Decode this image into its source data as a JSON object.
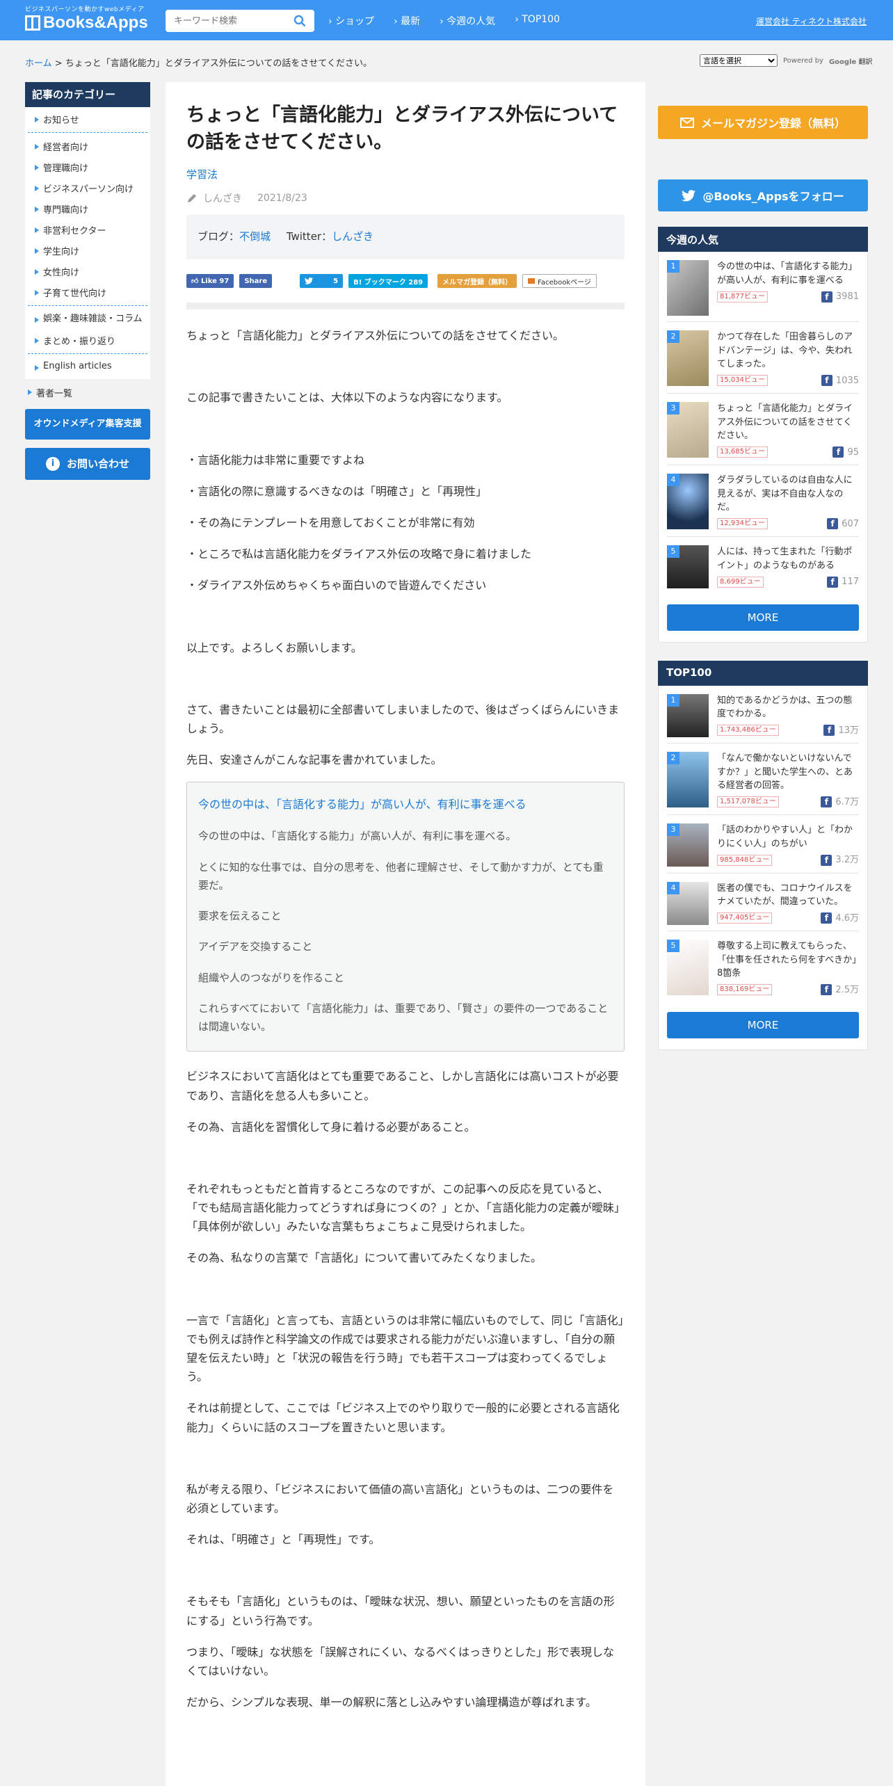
{
  "header": {
    "tagline": "ビジネスパーソンを動かすwebメディア",
    "logo": "Books&Apps",
    "search_placeholder": "キーワード検索",
    "nav": [
      "ショップ",
      "最新",
      "今週の人気",
      "TOP100"
    ],
    "operator": "運営会社 ティネクト株式会社"
  },
  "breadcrumb": {
    "home": "ホーム",
    "sep": " > ",
    "current": "ちょっと「言語化能力」とダライアス外伝についての話をさせてください。"
  },
  "translate": {
    "select": "言語を選択",
    "powered": "Powered by",
    "google": "Google",
    "label": "翻訳"
  },
  "sidebar": {
    "heading": "記事のカテゴリー",
    "group1": [
      "お知らせ"
    ],
    "group2": [
      "経営者向け",
      "管理職向け",
      "ビジネスパーソン向け",
      "専門職向け",
      "非営利セクター",
      "学生向け",
      "女性向け",
      "子育て世代向け"
    ],
    "group3": [
      "娯楽・趣味雑談・コラム",
      "まとめ・振り返り"
    ],
    "group4": [
      "English articles"
    ],
    "authors": "著者一覧",
    "owned_media": "オウンドメディア集客支援",
    "contact": "お問い合わせ"
  },
  "article": {
    "title": "ちょっと「言語化能力」とダライアス外伝についての話をさせてください。",
    "category": "学習法",
    "author": "しんざき",
    "date": "2021/8/23",
    "blog_label": "ブログ：",
    "blog_link": "不倒城",
    "twitter_label": "Twitter：",
    "twitter_link": "しんざき",
    "social": {
      "like": "Like 97",
      "share": "Share",
      "tweet": "5",
      "hatena": "B! ブックマーク 289",
      "mailmag": "メルマガ登録（無料）",
      "fbpage": "Facebookページ"
    },
    "p1": "ちょっと「言語化能力」とダライアス外伝についての話をさせてください。",
    "p2": "この記事で書きたいことは、大体以下のような内容になります。",
    "bullets": [
      "・言語化能力は非常に重要ですよね",
      "・言語化の際に意識するべきなのは「明確さ」と「再現性」",
      "・その為にテンプレートを用意しておくことが非常に有効",
      "・ところで私は言語化能力をダライアス外伝の攻略で身に着けました",
      "・ダライアス外伝めちゃくちゃ面白いので皆遊んでください"
    ],
    "p3": "以上です。よろしくお願いします。",
    "p4": "さて、書きたいことは最初に全部書いてしまいましたので、後はざっくばらんにいきましょう。",
    "p5": "先日、安達さんがこんな記事を書かれていました。",
    "quote": {
      "link": "今の世の中は、「言語化する能力」が高い人が、有利に事を運べる",
      "lines": [
        "今の世の中は、「言語化する能力」が高い人が、有利に事を運べる。",
        "とくに知的な仕事では、自分の思考を、他者に理解させ、そして動かす力が、とても重要だ。",
        "要求を伝えること",
        "アイデアを交換すること",
        "組織や人のつながりを作ること",
        "これらすべてにおいて「言語化能力」は、重要であり、「賢さ」の要件の一つであることは間違いない。"
      ]
    },
    "p6": "ビジネスにおいて言語化はとても重要であること、しかし言語化には高いコストが必要であり、言語化を怠る人も多いこと。",
    "p7": "その為、言語化を習慣化して身に着ける必要があること。",
    "p8": "それぞれもっともだと首肯するところなのですが、この記事への反応を見ていると、「でも結局言語化能力ってどうすれば身につくの？」とか、「言語化能力の定義が曖昧」「具体例が欲しい」みたいな言葉もちょこちょこ見受けられました。",
    "p9": "その為、私なりの言葉で「言語化」について書いてみたくなりました。",
    "p10": "一言で「言語化」と言っても、言語というのは非常に幅広いものでして、同じ「言語化」でも例えば詩作と科学論文の作成では要求される能力がだいぶ違いますし、「自分の願望を伝えたい時」と「状況の報告を行う時」でも若干スコープは変わってくるでしょう。",
    "p11": "それは前提として、ここでは「ビジネス上でのやり取りで一般的に必要とされる言語化能力」くらいに話のスコープを置きたいと思います。",
    "p12": "私が考える限り、「ビジネスにおいて価値の高い言語化」というものは、二つの要件を必須としています。",
    "p13": "それは、「明確さ」と「再現性」です。",
    "p14": "そもそも「言語化」というものは、「曖昧な状況、想い、願望といったものを言語の形にする」という行為です。",
    "p15": "つまり、「曖昧」な状態を「誤解されにくい、なるべくはっきりとした」形で表現しなくてはいけない。",
    "p16": "だから、シンプルな表現、単一の解釈に落とし込みやすい論理構造が尊ばれます。"
  },
  "right": {
    "mail": "メールマガジン登録（無料）",
    "follow": "@Books_Appsをフォロー",
    "weekly_heading": "今週の人気",
    "weekly": [
      {
        "rank": "1",
        "title": "今の世の中は、「言語化する能力」が高い人が、有利に事を運べる",
        "views": "81,877ビュー",
        "fb": "3981"
      },
      {
        "rank": "2",
        "title": "かつて存在した「田舎暮らしのアドバンテージ」は、今や、失われてしまった。",
        "views": "15,034ビュー",
        "fb": "1035"
      },
      {
        "rank": "3",
        "title": "ちょっと「言語化能力」とダライアス外伝についての話をさせてください。",
        "views": "13,685ビュー",
        "fb": "95"
      },
      {
        "rank": "4",
        "title": "ダラダラしているのは自由な人に見えるが、実は不自由な人なのだ。",
        "views": "12,934ビュー",
        "fb": "607"
      },
      {
        "rank": "5",
        "title": "人には、持って生まれた「行動ポイント」のようなものがある",
        "views": "8,699ビュー",
        "fb": "117"
      }
    ],
    "more": "MORE",
    "top_heading": "TOP100",
    "top": [
      {
        "rank": "1",
        "title": "知的であるかどうかは、五つの態度でわかる。",
        "views": "1,743,486ビュー",
        "fb": "13万"
      },
      {
        "rank": "2",
        "title": "「なんで働かないといけないんですか？」と聞いた学生への、とある経営者の回答。",
        "views": "1,517,078ビュー",
        "fb": "6.7万"
      },
      {
        "rank": "3",
        "title": "「話のわかりやすい人」と「わかりにくい人」のちがい",
        "views": "985,848ビュー",
        "fb": "3.2万"
      },
      {
        "rank": "4",
        "title": "医者の僕でも、コロナウイルスをナメていたが、間違っていた。",
        "views": "947,405ビュー",
        "fb": "4.6万"
      },
      {
        "rank": "5",
        "title": "尊敬する上司に教えてもらった、「仕事を任されたら何をすべきか」8箇条",
        "views": "838,169ビュー",
        "fb": "2.5万"
      }
    ]
  }
}
